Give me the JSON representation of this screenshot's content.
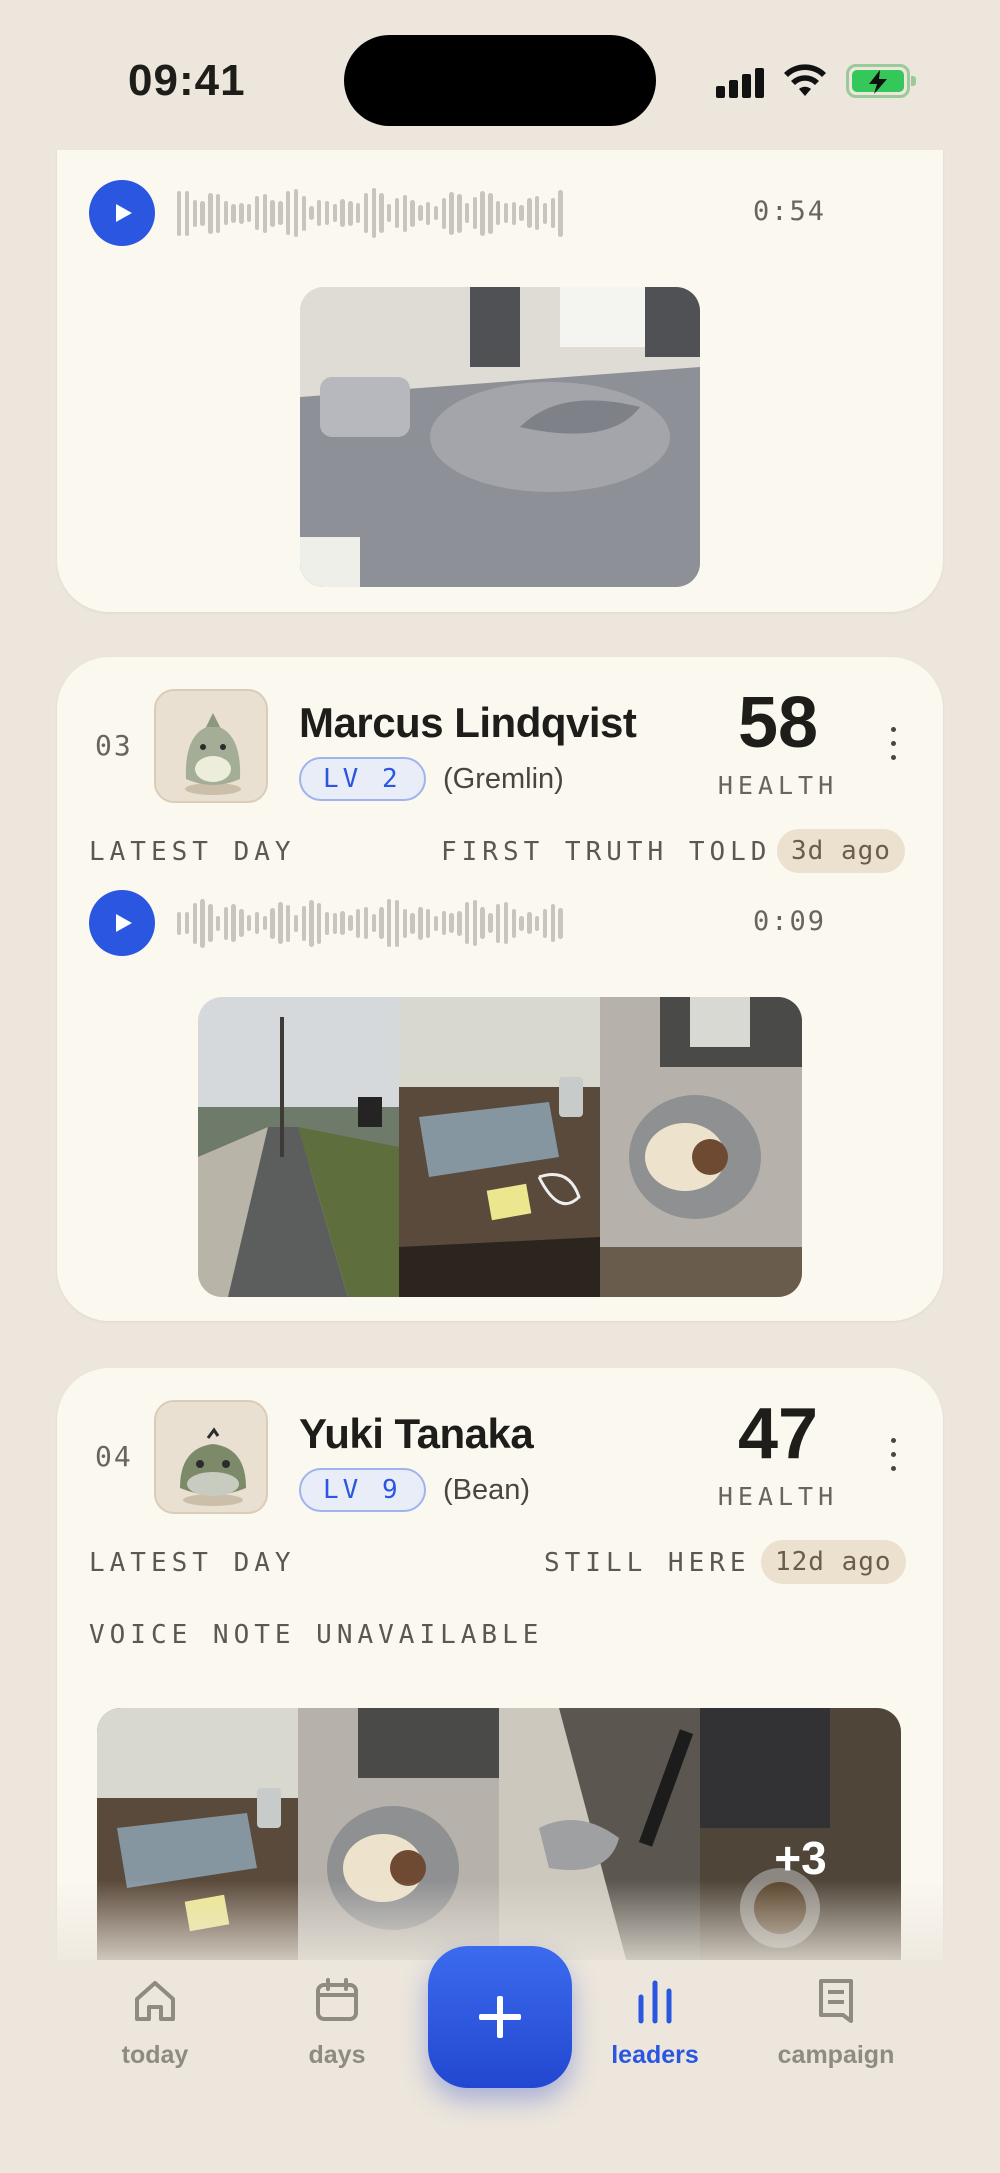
{
  "status_bar": {
    "time": "09:41"
  },
  "entries": [
    {
      "voice_duration": "0:54",
      "photos": [
        "bedroom-photo"
      ]
    },
    {
      "rank": "03",
      "name": "Marcus Lindqvist",
      "level": "LV 2",
      "creature": "(Gremlin)",
      "health": "58",
      "health_label": "HEALTH",
      "latest_day_label": "LATEST DAY",
      "latest_day_title": "FIRST TRUTH TOLD",
      "latest_day_ago": "3d ago",
      "voice_duration": "0:09",
      "photos": [
        "sidewalk-photo",
        "desk-photo",
        "meal-photo"
      ]
    },
    {
      "rank": "04",
      "name": "Yuki Tanaka",
      "level": "LV 9",
      "creature": "(Bean)",
      "health": "47",
      "health_label": "HEALTH",
      "latest_day_label": "LATEST DAY",
      "latest_day_title": "STILL HERE",
      "latest_day_ago": "12d ago",
      "voice_status": "VOICE NOTE UNAVAILABLE",
      "photos": [
        "desk-photo",
        "meal-photo",
        "cloth-photo",
        "cup-photo"
      ],
      "more_photos": "+3"
    }
  ],
  "nav": {
    "today": "today",
    "days": "days",
    "leaders": "leaders",
    "campaign": "campaign",
    "active": "leaders"
  },
  "colors": {
    "accent": "#2a56e0",
    "background": "#ece6dc",
    "card": "#fbf8f0"
  }
}
